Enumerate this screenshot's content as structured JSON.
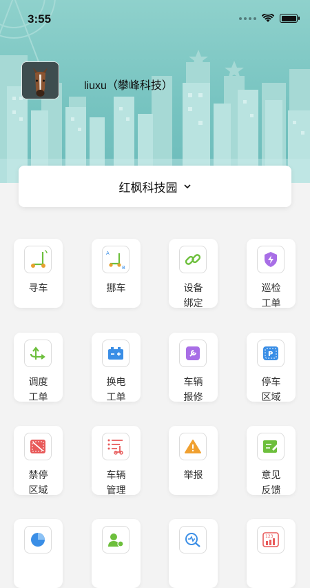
{
  "status_bar": {
    "time": "3:55"
  },
  "user": {
    "name": "liuxu（攀峰科技）"
  },
  "site_selector": {
    "label": "红枫科技园",
    "icon": "chevron-down-icon"
  },
  "colors": {
    "header_teal": "#76c3c0",
    "skyline": "#b6e2df",
    "green": "#6dbf3c",
    "blue": "#3a8ee6",
    "purple": "#a86ee6",
    "red": "#e85a5a",
    "orange": "#f0a030"
  },
  "menu": [
    {
      "label": "寻车",
      "icon": "scooter-locate-icon"
    },
    {
      "label": "挪车",
      "icon": "scooter-move-icon"
    },
    {
      "label": "设备\n绑定",
      "icon": "link-icon"
    },
    {
      "label": "巡检\n工单",
      "icon": "shield-lightning-icon"
    },
    {
      "label": "调度\n工单",
      "icon": "dispatch-arrows-icon"
    },
    {
      "label": "换电\n工单",
      "icon": "battery-icon"
    },
    {
      "label": "车辆\n报修",
      "icon": "repair-wrench-icon"
    },
    {
      "label": "停车\n区域",
      "icon": "parking-icon"
    },
    {
      "label": "禁停\n区域",
      "icon": "no-parking-icon"
    },
    {
      "label": "车辆\n管理",
      "icon": "vehicle-list-icon"
    },
    {
      "label": "举报",
      "icon": "warning-icon"
    },
    {
      "label": "意见\n反馈",
      "icon": "feedback-edit-icon"
    },
    {
      "label": "",
      "icon": "pie-chart-icon"
    },
    {
      "label": "",
      "icon": "user-settings-icon"
    },
    {
      "label": "",
      "icon": "search-monitor-icon"
    },
    {
      "label": "",
      "icon": "statistics-123-icon"
    }
  ]
}
